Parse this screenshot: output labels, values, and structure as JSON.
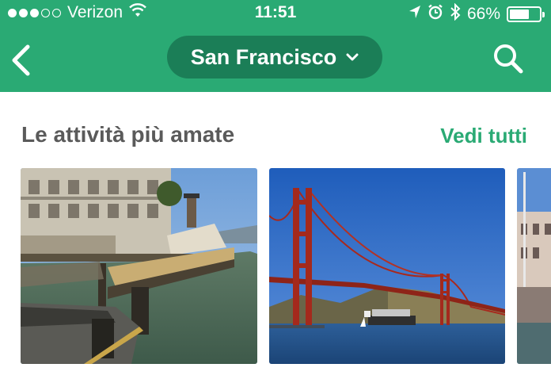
{
  "status_bar": {
    "carrier": "Verizon",
    "time": "11:51",
    "battery_percent": "66%",
    "battery_level": 0.66,
    "icons": [
      "signal-dots-icon",
      "wifi-icon",
      "location-arrow-icon",
      "alarm-icon",
      "bluetooth-icon",
      "battery-icon"
    ]
  },
  "header": {
    "city": "San Francisco",
    "back_icon": "chevron-left-icon",
    "dropdown_icon": "chevron-down-icon",
    "search_icon": "search-icon"
  },
  "section": {
    "title": "Le attività più amate",
    "see_all": "Vedi tutti"
  },
  "cards": [
    {
      "image": "alcatraz-pier-photo"
    },
    {
      "image": "golden-gate-bridge-photo"
    },
    {
      "image": "waterfront-pier-photo"
    }
  ],
  "colors": {
    "brand_green": "#2aaa74",
    "pill_green": "#1b7e57",
    "title_gray": "#5a5a5a"
  }
}
